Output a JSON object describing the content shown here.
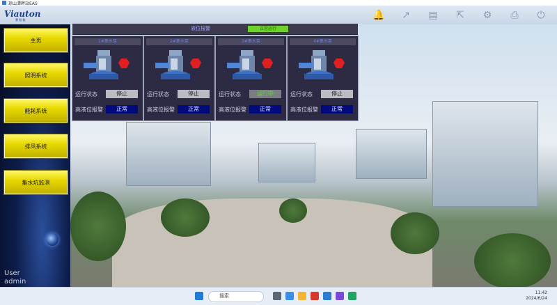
{
  "window": {
    "title": "琼山潭畔站EAS"
  },
  "header": {
    "logo": "Viauton",
    "logo_sub": "慧 智 能",
    "icons": [
      "bell-icon",
      "trend-icon",
      "report-icon",
      "export-icon",
      "settings-icon",
      "print-icon",
      "power-icon"
    ]
  },
  "sidebar": {
    "items": [
      {
        "label": "主页"
      },
      {
        "label": "照明系统"
      },
      {
        "label": "能耗系统"
      },
      {
        "label": "排风系统"
      },
      {
        "label": "集水坑监测"
      }
    ],
    "user_label": "User",
    "user_name": "admin"
  },
  "status_bar": {
    "label": "液位报警",
    "indicator": "正常运行"
  },
  "panels": [
    {
      "title": "1#集水泵",
      "run_label": "运行状态",
      "run_value": "停止",
      "run_state": "stop",
      "alarm_label": "高液位报警",
      "alarm_value": "正常"
    },
    {
      "title": "2#集水泵",
      "run_label": "运行状态",
      "run_value": "停止",
      "run_state": "stop",
      "alarm_label": "高液位报警",
      "alarm_value": "正常"
    },
    {
      "title": "3#集水泵",
      "run_label": "运行状态",
      "run_value": "运行中",
      "run_state": "run",
      "alarm_label": "高液位报警",
      "alarm_value": "正常"
    },
    {
      "title": "4#集水泵",
      "run_label": "运行状态",
      "run_value": "停止",
      "run_state": "stop",
      "alarm_label": "高液位报警",
      "alarm_value": "正常"
    }
  ],
  "taskbar": {
    "search_placeholder": "搜索",
    "time": "11:42",
    "date": "2024/6/24"
  },
  "colors": {
    "nav_yellow": "#e8d900",
    "panel_bg": "#2d2a44",
    "running_green": "#63d72c",
    "alarm_blue": "#000a7a"
  }
}
